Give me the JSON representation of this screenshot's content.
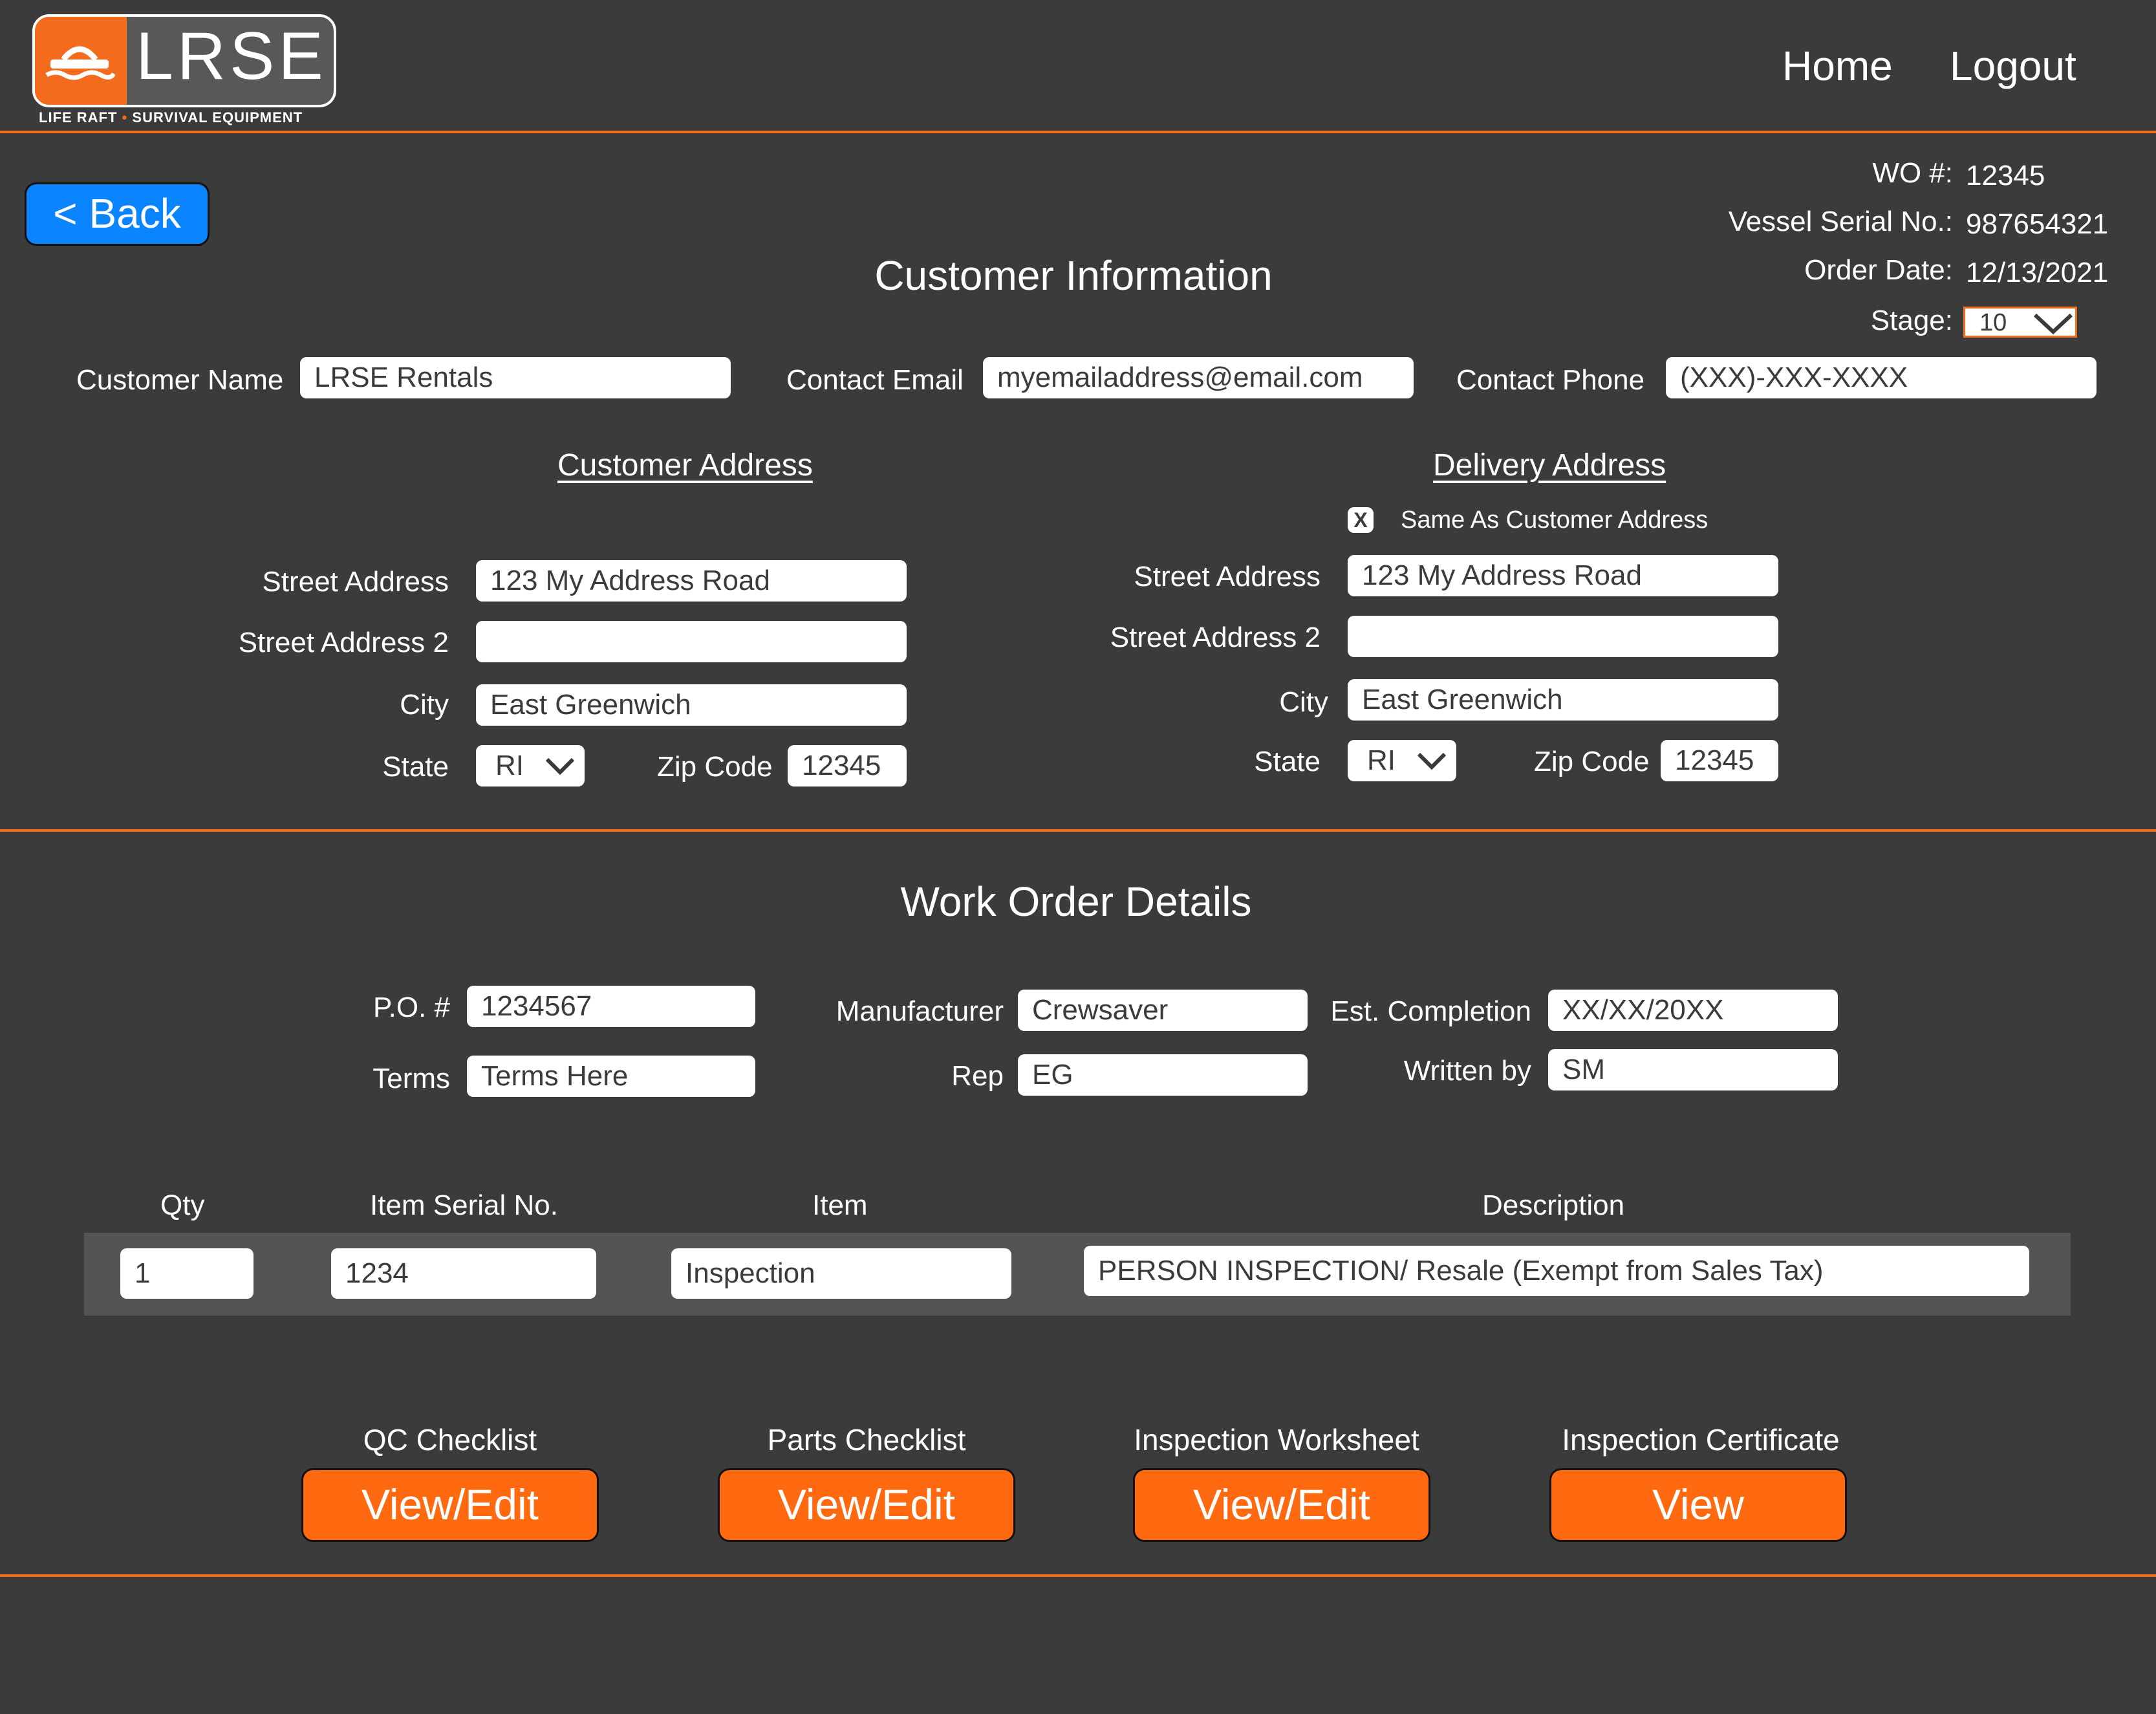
{
  "header": {
    "logo_text": "LRSE",
    "logo_tagline_left": "LIFE RAFT",
    "logo_tagline_dot": "•",
    "logo_tagline_right": "SURVIVAL EQUIPMENT",
    "nav": {
      "home": "Home",
      "logout": "Logout"
    }
  },
  "back_button": "< Back",
  "order_meta": {
    "wo_label": "WO #:",
    "wo_value": "12345",
    "vessel_label": "Vessel Serial No.:",
    "vessel_value": "987654321",
    "date_label": "Order Date:",
    "date_value": "12/13/2021",
    "stage_label": "Stage:",
    "stage_value": "10"
  },
  "customer_info": {
    "title": "Customer Information",
    "name_label": "Customer Name",
    "name_value": "LRSE Rentals",
    "email_label": "Contact Email",
    "email_value": "myemailaddress@email.com",
    "phone_label": "Contact Phone",
    "phone_value": "(XXX)-XXX-XXXX"
  },
  "customer_address": {
    "title": "Customer Address",
    "street_label": "Street Address",
    "street_value": "123 My Address Road",
    "street2_label": "Street Address 2",
    "street2_value": "",
    "city_label": "City",
    "city_value": "East Greenwich",
    "state_label": "State",
    "state_value": "RI",
    "zip_label": "Zip Code",
    "zip_value": "12345"
  },
  "delivery_address": {
    "title": "Delivery Address",
    "same_as_checkbox_mark": "X",
    "same_as_label": "Same As Customer Address",
    "street_label": "Street Address",
    "street_value": "123 My Address Road",
    "street2_label": "Street Address 2",
    "street2_value": "",
    "city_label": "City",
    "city_value": "East Greenwich",
    "state_label": "State",
    "state_value": "RI",
    "zip_label": "Zip Code",
    "zip_value": "12345"
  },
  "work_order": {
    "title": "Work Order Details",
    "po_label": "P.O. #",
    "po_value": "1234567",
    "terms_label": "Terms",
    "terms_value": "Terms Here",
    "manufacturer_label": "Manufacturer",
    "manufacturer_value": "Crewsaver",
    "rep_label": "Rep",
    "rep_value": "EG",
    "completion_label": "Est. Completion",
    "completion_value": "XX/XX/20XX",
    "written_label": "Written by",
    "written_value": "SM"
  },
  "items_table": {
    "headers": {
      "qty": "Qty",
      "serial": "Item Serial No.",
      "item": "Item",
      "description": "Description"
    },
    "rows": [
      {
        "qty": "1",
        "serial": "1234",
        "item": "Inspection",
        "description": "PERSON INSPECTION/ Resale (Exempt from Sales Tax)"
      }
    ]
  },
  "actions": [
    {
      "caption": "QC Checklist",
      "button": "View/Edit"
    },
    {
      "caption": "Parts Checklist",
      "button": "View/Edit"
    },
    {
      "caption": "Inspection Worksheet",
      "button": "View/Edit"
    },
    {
      "caption": "Inspection Certificate",
      "button": "View"
    }
  ],
  "colors": {
    "background": "#3b3b3b",
    "accent_orange": "#f36b1c",
    "button_orange": "#ff6a10",
    "back_button_blue": "#0a84ff",
    "table_row_bg": "#545454"
  }
}
